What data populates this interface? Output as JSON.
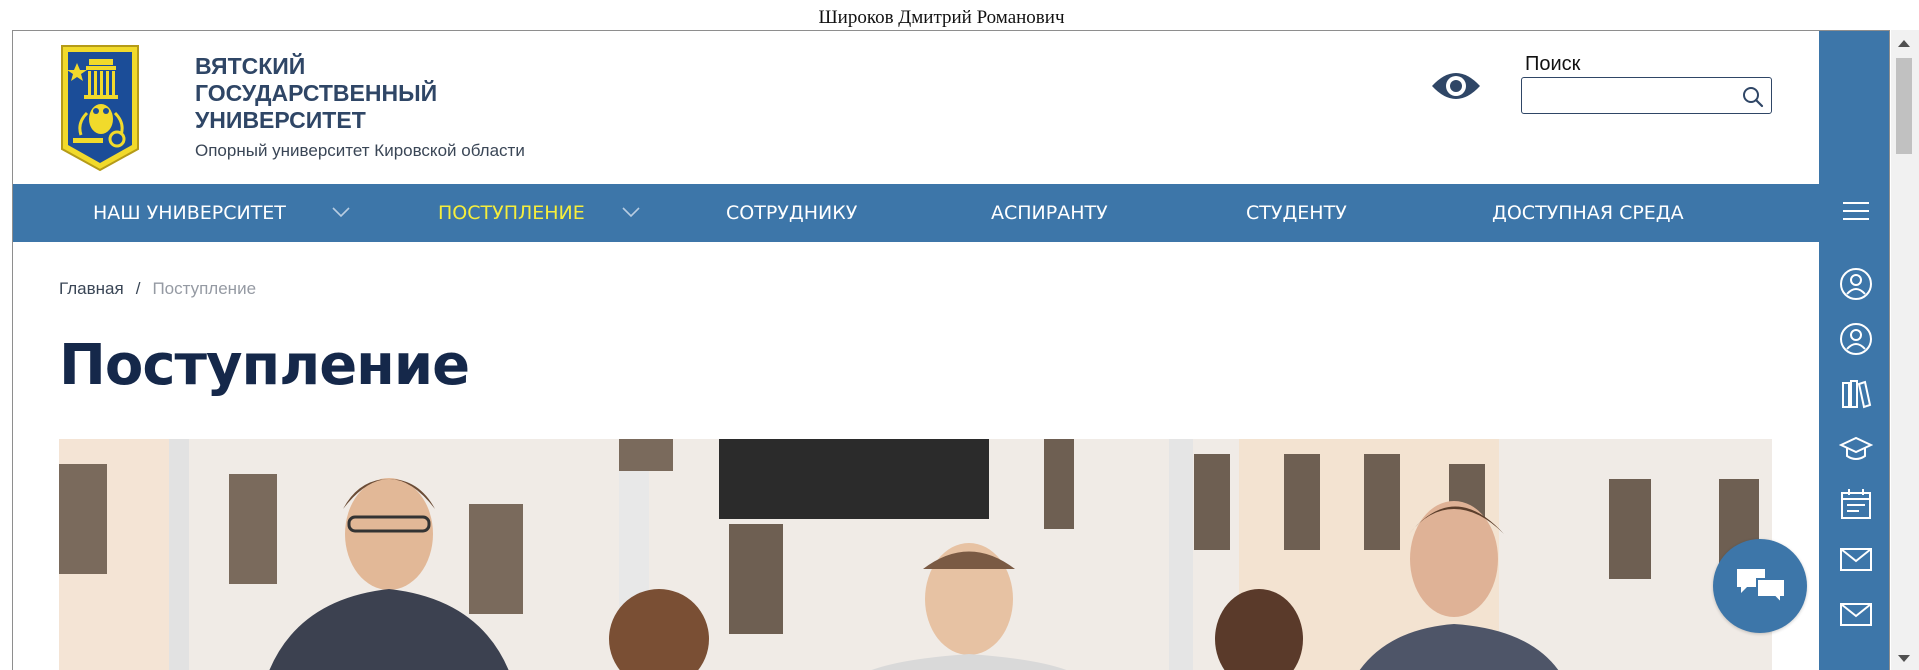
{
  "user": {
    "name": "Широков Дмитрий Романович"
  },
  "header": {
    "brand_name": "ВЯТСКИЙ ГОСУДАРСТВЕННЫЙ УНИВЕРСИТЕТ",
    "brand_sub": "Опорный университет Кировской области",
    "search_label": "Поиск",
    "search_value": "",
    "search_placeholder": ""
  },
  "nav": {
    "items": [
      {
        "label": "НАШ УНИВЕРСИТЕТ",
        "has_dropdown": true
      },
      {
        "label": "ПОСТУПЛЕНИЕ",
        "has_dropdown": true,
        "active": true
      },
      {
        "label": "СОТРУДНИКУ"
      },
      {
        "label": "АСПИРАНТУ"
      },
      {
        "label": "СТУДЕНТУ"
      },
      {
        "label": "ДОСТУПНАЯ СРЕДА"
      }
    ]
  },
  "breadcrumb": {
    "home": "Главная",
    "separator": "/",
    "current": "Поступление"
  },
  "page": {
    "title": "Поступление"
  },
  "side_panel": {
    "icons": [
      "menu-icon",
      "user-account-icon",
      "user-profile-icon",
      "library-books-icon",
      "graduation-cap-icon",
      "calendar-icon",
      "mail-icon",
      "mail-icon"
    ]
  },
  "colors": {
    "brand_blue": "#3d76a9",
    "active_nav": "#f6ee3c",
    "title": "#15284a"
  },
  "widgets": {
    "accessibility": "eye-icon",
    "chat": "chat-icon"
  }
}
